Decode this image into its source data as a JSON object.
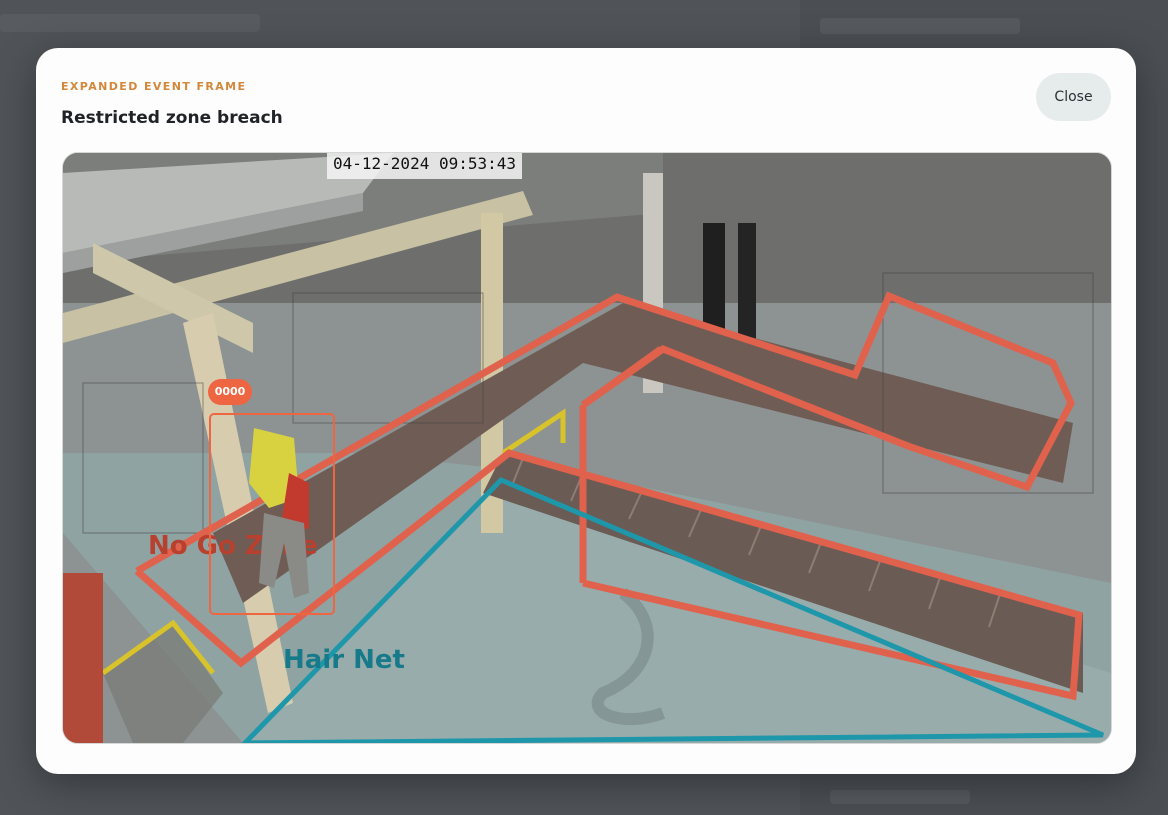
{
  "modal": {
    "eyebrow": "EXPANDED EVENT FRAME",
    "title": "Restricted zone breach",
    "close_label": "Close"
  },
  "frame": {
    "timestamp": "04-12-2024 09:53:43",
    "zones": [
      {
        "name": "No Go Zone",
        "color": "#e0614c"
      },
      {
        "name": "Hair Net",
        "color": "#1f97aa"
      }
    ],
    "detection": {
      "id": "0000",
      "color": "#ee6542"
    }
  },
  "colors": {
    "eyebrow": "#d2873a",
    "close_bg": "#e6ecec",
    "no_go": "#e0614c",
    "hair_net": "#1f97aa",
    "detection": "#ee6542"
  }
}
